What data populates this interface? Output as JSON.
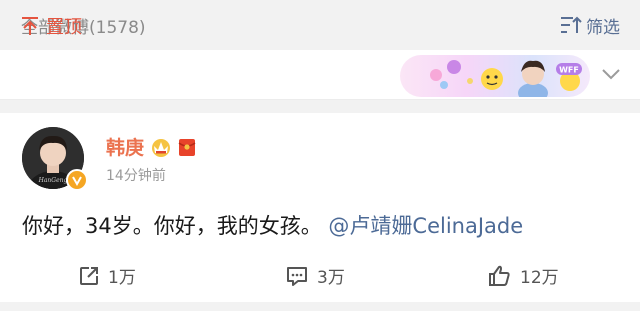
{
  "header": {
    "count_label": "全部微博(1578)",
    "filter_label": "筛选"
  },
  "pinned": {
    "label": "置顶",
    "banner_badge": "WFF"
  },
  "post": {
    "username": "韩庚",
    "timestamp": "14分钟前",
    "text": "你好，34岁。你好，我的女孩。",
    "mention": "@卢靖姗CelinaJade",
    "avatar_caption": "HanGeng"
  },
  "actions": {
    "repost_count": "1万",
    "comment_count": "3万",
    "like_count": "12万"
  },
  "colors": {
    "accent_orange": "#eb7350",
    "pin_red": "#e5543f",
    "link_blue": "#4c6a96",
    "filter_blue": "#596f94"
  }
}
